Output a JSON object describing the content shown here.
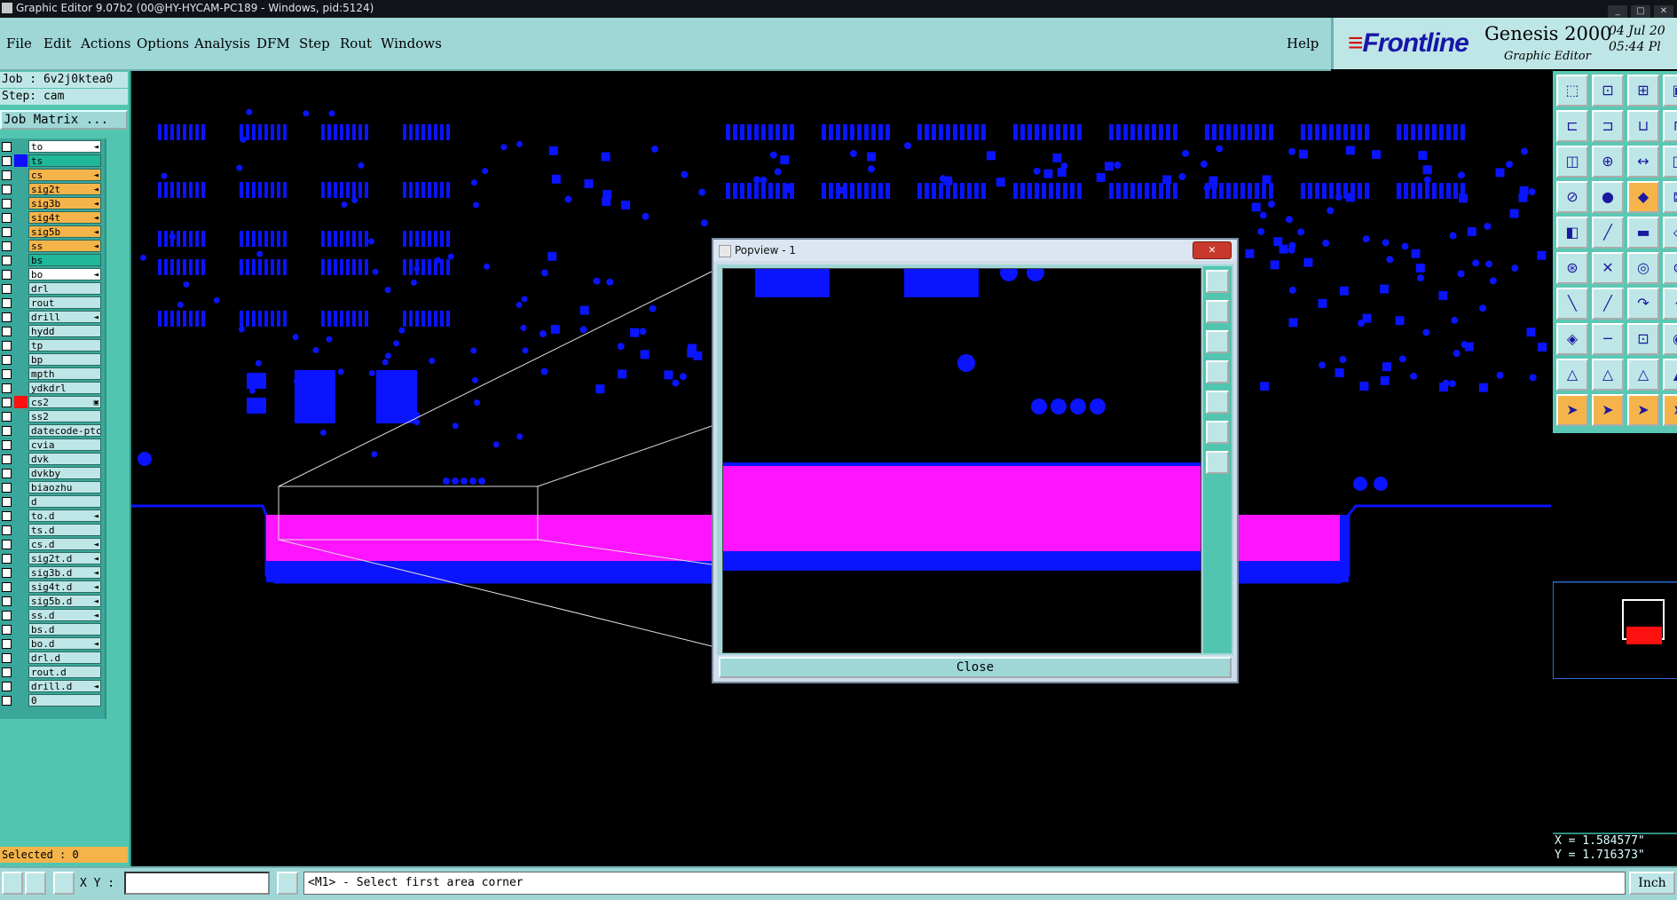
{
  "window": {
    "title": "Graphic Editor 9.07b2 (00@HY-HYCAM-PC189 - Windows, pid:5124)"
  },
  "menu": {
    "items": [
      "File",
      "Edit",
      "Actions",
      "Options",
      "Analysis",
      "DFM",
      "Step",
      "Rout",
      "Windows"
    ],
    "help": "Help"
  },
  "brand": {
    "logo": "Frontline",
    "product": "Genesis 2000",
    "subtitle": "Graphic Editor",
    "date": "04 Jul 20",
    "time": "05:44 Pl"
  },
  "job": {
    "job_line": "Job : 6v2j0ktea0",
    "step_line": "Step: cam",
    "matrix_button": "Job Matrix ..."
  },
  "layers": [
    {
      "name": "to",
      "color": "#ffffff",
      "swatch": "",
      "mark": "◄"
    },
    {
      "name": "ts",
      "color": "#1fb89a",
      "swatch": "#1010ff",
      "mark": ""
    },
    {
      "name": "cs",
      "color": "#f4b44a",
      "swatch": "",
      "mark": "◄"
    },
    {
      "name": "sig2t",
      "color": "#f4b44a",
      "swatch": "",
      "mark": "◄"
    },
    {
      "name": "sig3b",
      "color": "#f4b44a",
      "swatch": "",
      "mark": "◄"
    },
    {
      "name": "sig4t",
      "color": "#f4b44a",
      "swatch": "",
      "mark": "◄"
    },
    {
      "name": "sig5b",
      "color": "#f4b44a",
      "swatch": "",
      "mark": "◄"
    },
    {
      "name": "ss",
      "color": "#f4b44a",
      "swatch": "",
      "mark": "◄"
    },
    {
      "name": "bs",
      "color": "#1fb89a",
      "swatch": "",
      "mark": ""
    },
    {
      "name": "bo",
      "color": "#ffffff",
      "swatch": "",
      "mark": "◄"
    },
    {
      "name": "drl",
      "color": "#bfe6e6",
      "swatch": "",
      "mark": ""
    },
    {
      "name": "rout",
      "color": "#bfe6e6",
      "swatch": "",
      "mark": ""
    },
    {
      "name": "drill",
      "color": "#bfe6e6",
      "swatch": "",
      "mark": "◄"
    },
    {
      "name": "hydd",
      "color": "#bfe6e6",
      "swatch": "",
      "mark": ""
    },
    {
      "name": "tp",
      "color": "#bfe6e6",
      "swatch": "",
      "mark": ""
    },
    {
      "name": "bp",
      "color": "#bfe6e6",
      "swatch": "",
      "mark": ""
    },
    {
      "name": "mpth",
      "color": "#bfe6e6",
      "swatch": "",
      "mark": ""
    },
    {
      "name": "ydkdrl",
      "color": "#bfe6e6",
      "swatch": "",
      "mark": ""
    },
    {
      "name": "cs2",
      "color": "#bfe6e6",
      "swatch": "#ff1010",
      "mark": "▣"
    },
    {
      "name": "ss2",
      "color": "#bfe6e6",
      "swatch": "",
      "mark": ""
    },
    {
      "name": "datecode-ptc",
      "color": "#bfe6e6",
      "swatch": "",
      "mark": ""
    },
    {
      "name": "cvia",
      "color": "#bfe6e6",
      "swatch": "",
      "mark": ""
    },
    {
      "name": "dvk",
      "color": "#bfe6e6",
      "swatch": "",
      "mark": ""
    },
    {
      "name": "dvkby",
      "color": "#bfe6e6",
      "swatch": "",
      "mark": ""
    },
    {
      "name": "biaozhu",
      "color": "#bfe6e6",
      "swatch": "",
      "mark": ""
    },
    {
      "name": "d",
      "color": "#bfe6e6",
      "swatch": "",
      "mark": ""
    },
    {
      "name": "to.d",
      "color": "#bfe6e6",
      "swatch": "",
      "mark": "◄"
    },
    {
      "name": "ts.d",
      "color": "#bfe6e6",
      "swatch": "",
      "mark": ""
    },
    {
      "name": "cs.d",
      "color": "#bfe6e6",
      "swatch": "",
      "mark": "◄"
    },
    {
      "name": "sig2t.d",
      "color": "#bfe6e6",
      "swatch": "",
      "mark": "◄"
    },
    {
      "name": "sig3b.d",
      "color": "#bfe6e6",
      "swatch": "",
      "mark": "◄"
    },
    {
      "name": "sig4t.d",
      "color": "#bfe6e6",
      "swatch": "",
      "mark": "◄"
    },
    {
      "name": "sig5b.d",
      "color": "#bfe6e6",
      "swatch": "",
      "mark": "◄"
    },
    {
      "name": "ss.d",
      "color": "#bfe6e6",
      "swatch": "",
      "mark": "◄"
    },
    {
      "name": "bs.d",
      "color": "#bfe6e6",
      "swatch": "",
      "mark": ""
    },
    {
      "name": "bo.d",
      "color": "#bfe6e6",
      "swatch": "",
      "mark": "◄"
    },
    {
      "name": "drl.d",
      "color": "#bfe6e6",
      "swatch": "",
      "mark": ""
    },
    {
      "name": "rout.d",
      "color": "#bfe6e6",
      "swatch": "",
      "mark": ""
    },
    {
      "name": "drill.d",
      "color": "#bfe6e6",
      "swatch": "",
      "mark": "◄"
    },
    {
      "name": "0",
      "color": "#bfe6e6",
      "swatch": "",
      "mark": ""
    }
  ],
  "selected": "Selected : 0",
  "popview": {
    "title": "Popview - 1",
    "close_label": "Close",
    "close_x": "✕"
  },
  "coords": {
    "x": "X = 1.584577\"",
    "y": "Y = 1.716373\""
  },
  "status": {
    "xy_label": "X Y :",
    "xy_value": "",
    "prompt": "<M1> - Select first area corner",
    "units": "Inch"
  },
  "colors": {
    "board_features": "#0a14ff",
    "highlight": "#ff14ff",
    "panel": "#52c5b0",
    "menu": "#9fd7d7"
  }
}
